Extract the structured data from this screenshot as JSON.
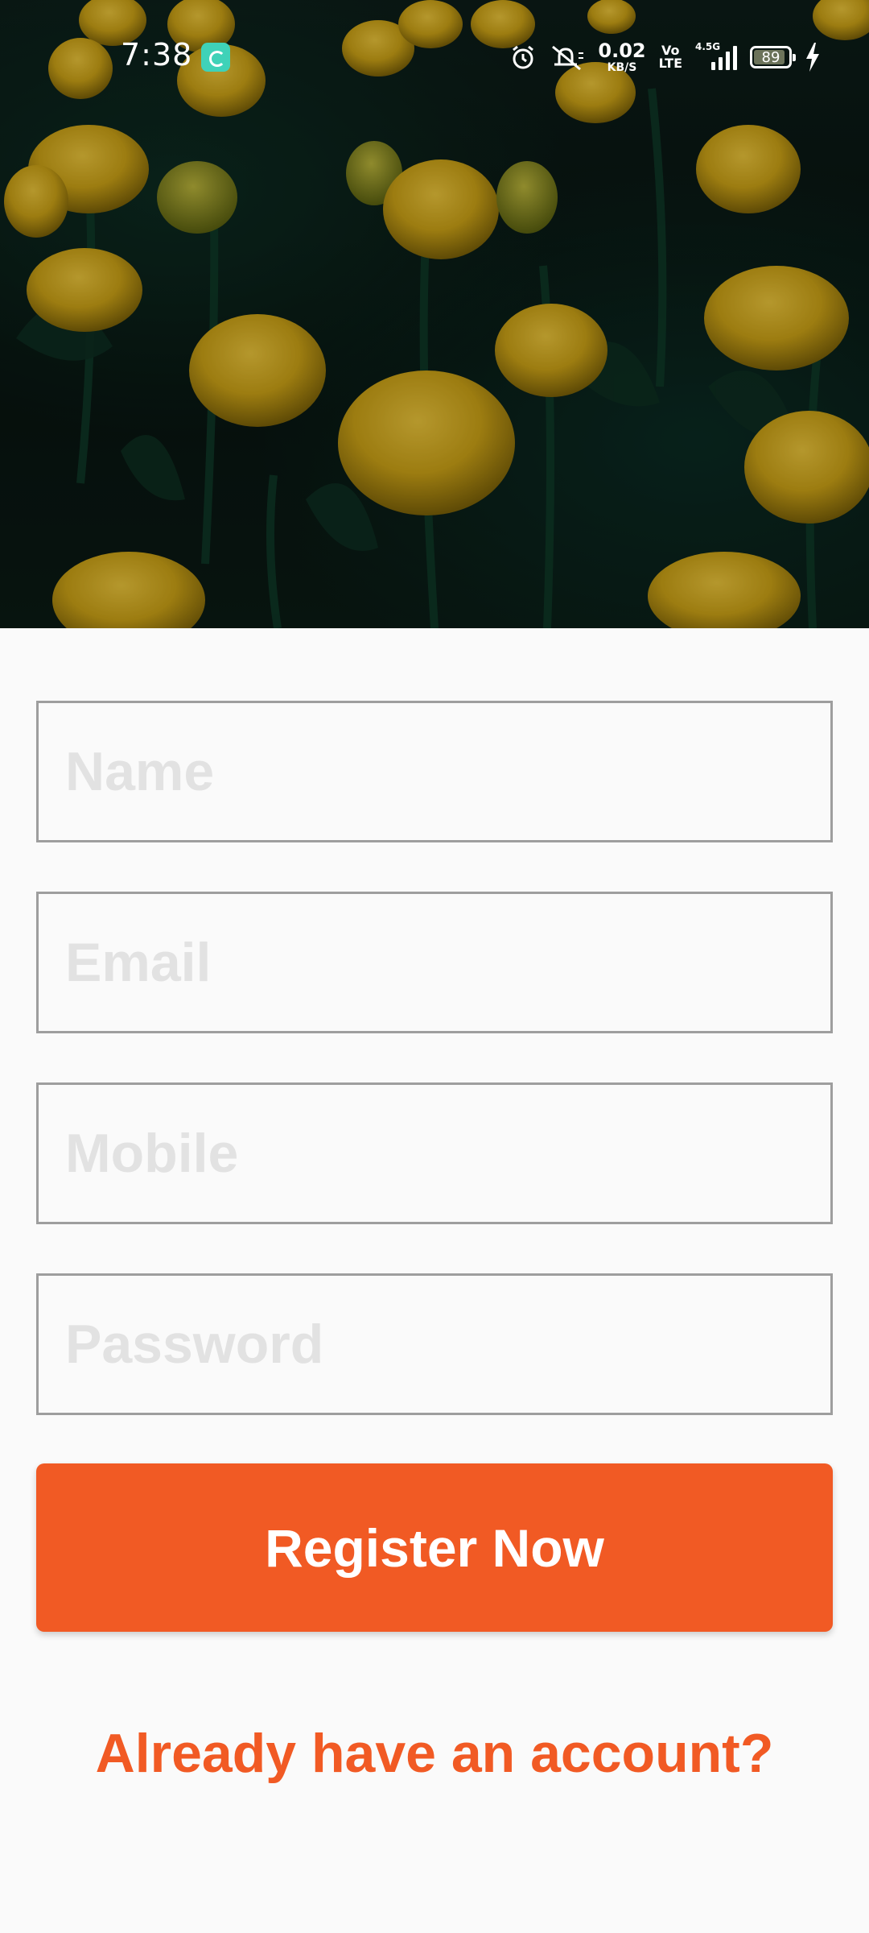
{
  "status_bar": {
    "time": "7:38",
    "net_speed_value": "0.02",
    "net_speed_unit": "KB/S",
    "volte_top": "Vo",
    "volte_bottom": "LTE",
    "network_type": "4.5G",
    "battery_level": "89",
    "icons": [
      "app-notification-icon",
      "alarm-icon",
      "mute-icon",
      "signal-icon",
      "battery-icon",
      "charging-icon"
    ]
  },
  "hero": {
    "image": "yellow-tulips-photo"
  },
  "form": {
    "name_placeholder": "Name",
    "email_placeholder": "Email",
    "mobile_placeholder": "Mobile",
    "password_placeholder": "Password"
  },
  "actions": {
    "register_label": "Register Now",
    "login_link_label": "Already have an account?"
  },
  "colors": {
    "accent": "#f15a24",
    "background": "#fafafa",
    "field_border": "#9e9e9e",
    "placeholder": "#e2e2e2"
  }
}
